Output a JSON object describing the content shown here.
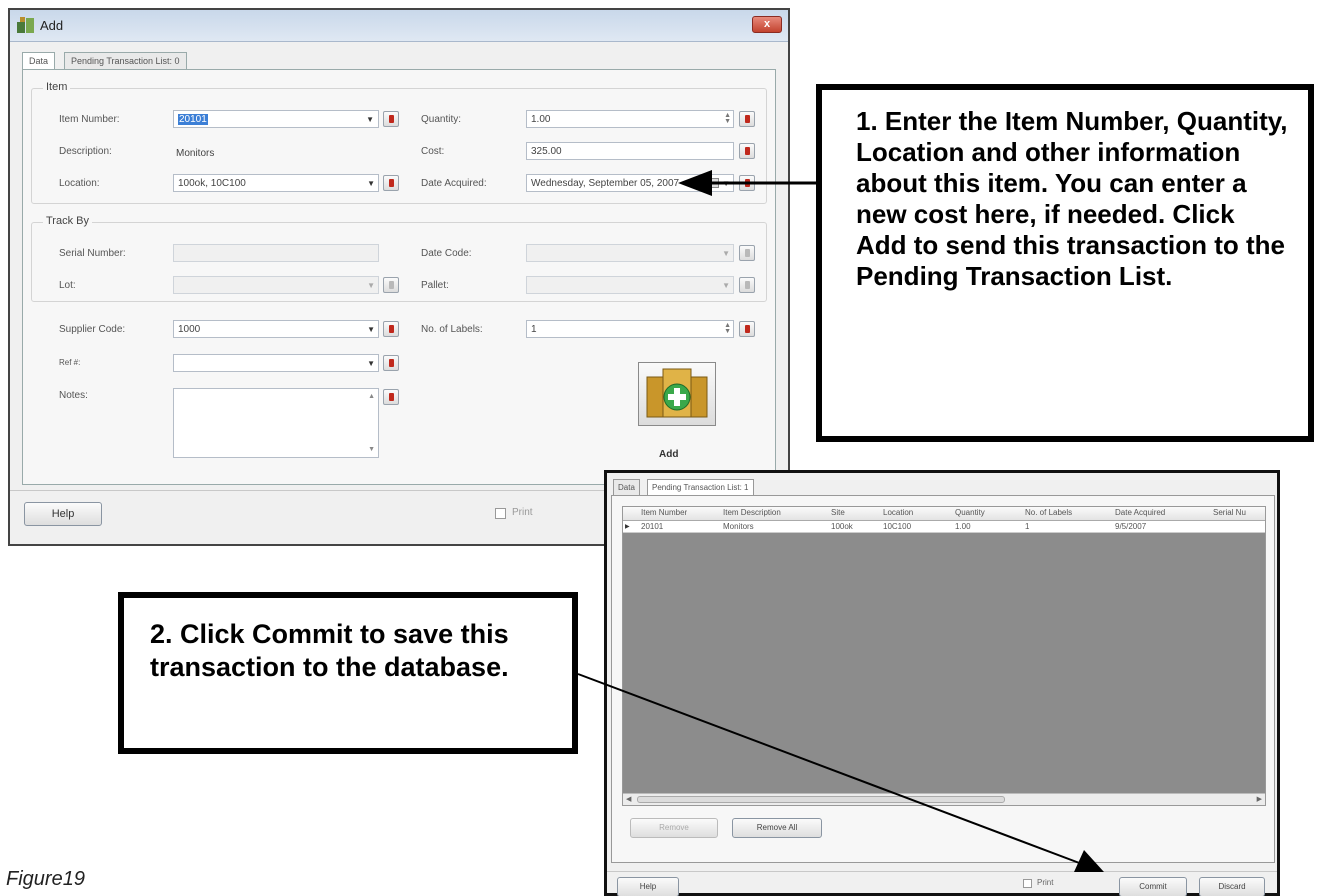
{
  "add_window": {
    "title": "Add",
    "close_label": "x",
    "tabs": [
      "Data",
      "Pending Transaction List: 0"
    ],
    "item_group_label": "Item",
    "item_number": {
      "label": "Item Number:",
      "value": "20101"
    },
    "description": {
      "label": "Description:",
      "value": "Monitors"
    },
    "location": {
      "label": "Location:",
      "value": "100ok, 10C100"
    },
    "quantity": {
      "label": "Quantity:",
      "value": "1.00"
    },
    "cost": {
      "label": "Cost:",
      "value": "325.00"
    },
    "date_acquired": {
      "label": "Date Acquired:",
      "value": "Wednesday, September 05, 2007"
    },
    "track_by_label": "Track By",
    "serial_number": {
      "label": "Serial Number:",
      "value": ""
    },
    "lot": {
      "label": "Lot:",
      "value": ""
    },
    "date_code": {
      "label": "Date Code:",
      "value": ""
    },
    "pallet": {
      "label": "Pallet:",
      "value": ""
    },
    "supplier_code": {
      "label": "Supplier Code:",
      "value": "1000"
    },
    "no_of_labels": {
      "label": "No. of Labels:",
      "value": "1"
    },
    "ref": {
      "label": "Ref #:",
      "value": ""
    },
    "notes": {
      "label": "Notes:",
      "value": ""
    },
    "add_button_label": "Add",
    "help_label": "Help",
    "print_label": "Print"
  },
  "callout_1": "1. Enter the Item Number, Quantity, Location and other information about this item. You can enter a new cost here, if needed. Click Add to send this transaction to the Pending Transaction List.",
  "callout_2": "2. Click Commit to save this transaction to the database.",
  "pending_window": {
    "tabs": [
      "Data",
      "Pending Transaction List: 1"
    ],
    "columns": [
      "Item Number",
      "Item Description",
      "Site",
      "Location",
      "Quantity",
      "No. of Labels",
      "Date Acquired",
      "Serial Nu"
    ],
    "rows": [
      [
        "20101",
        "Monitors",
        "100ok",
        "10C100",
        "1.00",
        "1",
        "9/5/2007",
        ""
      ]
    ],
    "remove_label": "Remove",
    "remove_all_label": "Remove All",
    "help_label": "Help",
    "print_label": "Print",
    "commit_label": "Commit",
    "discard_label": "Discard"
  },
  "figure_caption": "Figure19",
  "icons": {
    "app": "inventory-app-icon",
    "add": "boxes-with-plus-icon",
    "required": "required-marker-icon"
  },
  "colors": {
    "title_bar": "#dfe8f3",
    "close_button": "#c2432f",
    "required_marker": "#c0281c",
    "selection": "#3c7fd6",
    "grid_background": "#8c8c8c"
  }
}
